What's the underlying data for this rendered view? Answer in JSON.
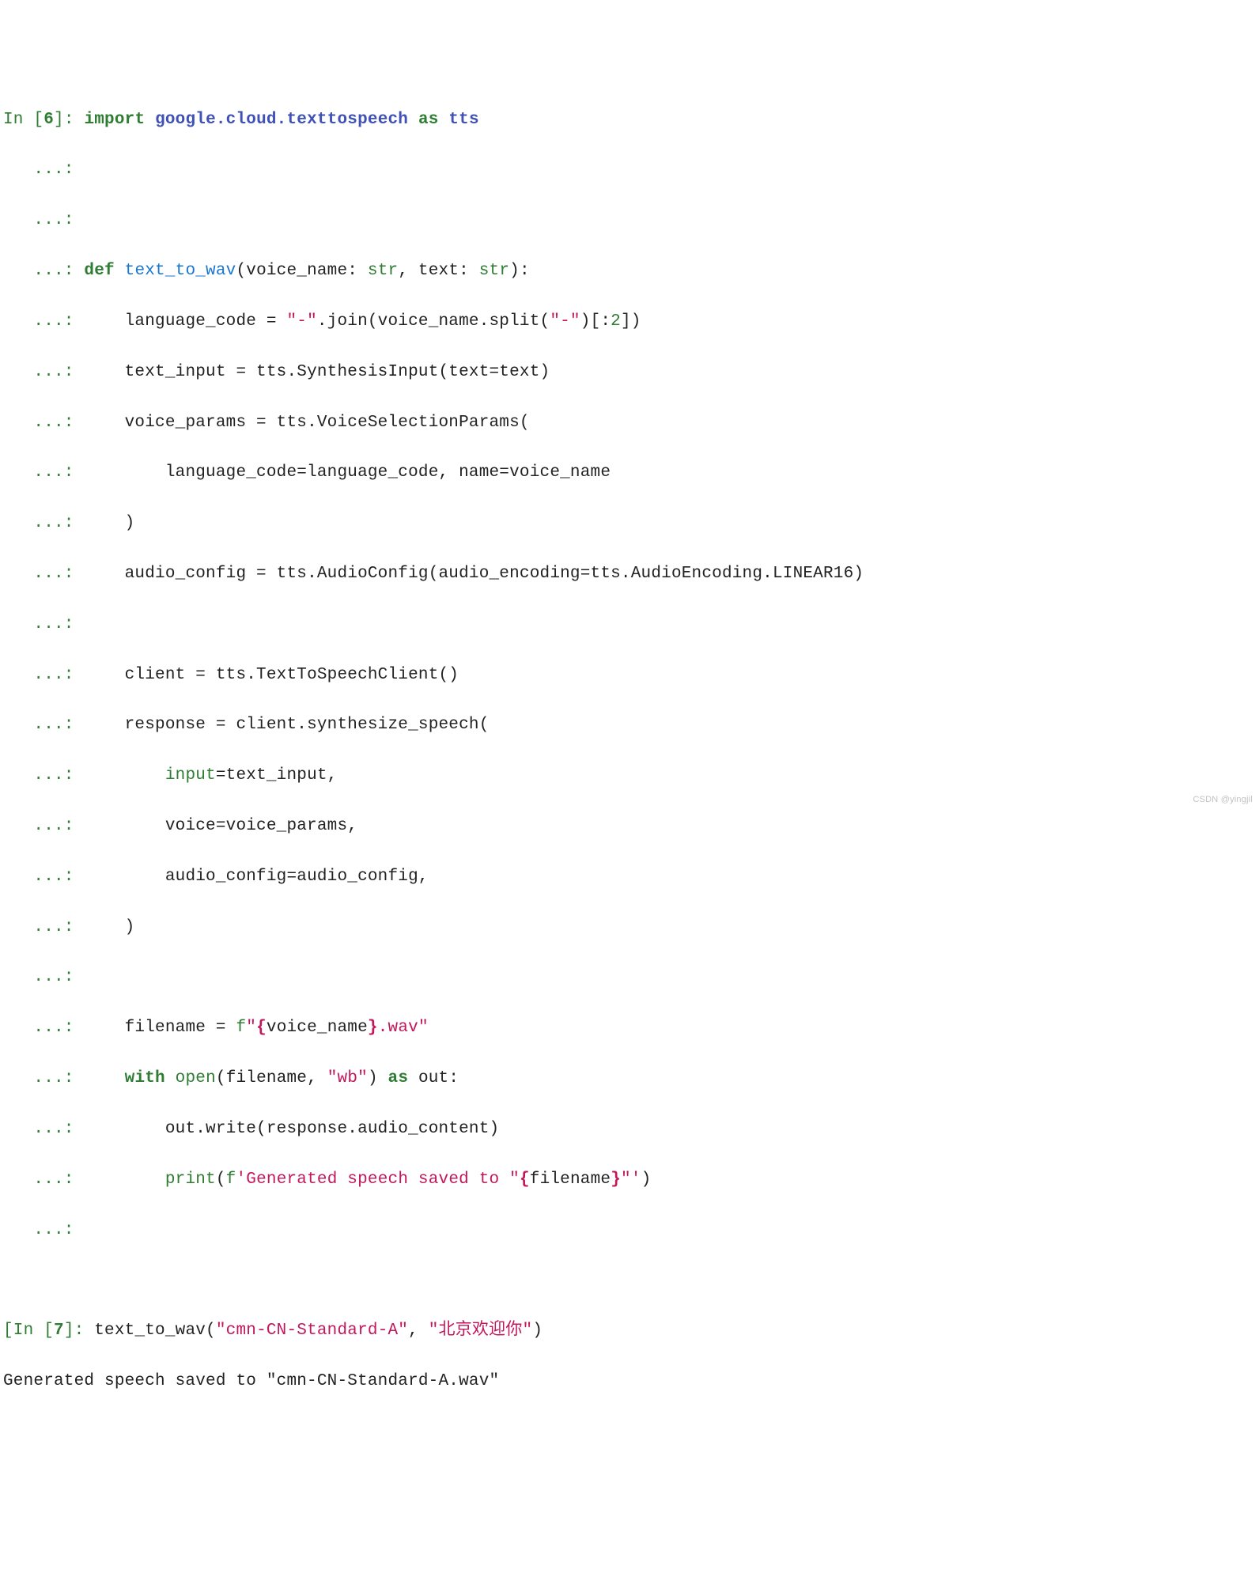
{
  "cells": {
    "cell6": {
      "prompt_in": "In [",
      "prompt_num": "6",
      "prompt_close": "]: ",
      "cont": "   ...: ",
      "line1": {
        "import": "import",
        "module": "google.cloud.texttospeech",
        "as": "as",
        "alias": "tts"
      },
      "line4": {
        "def": "def",
        "fname": "text_to_wav",
        "sig_open": "(voice_name: ",
        "type1": "str",
        "sig_mid": ", text: ",
        "type2": "str",
        "sig_close": "):"
      },
      "line5": {
        "indent": "    language_code = ",
        "str1": "\"-\"",
        "mid": ".join(voice_name.split(",
        "str2": "\"-\"",
        "tail": ")[:",
        "num": "2",
        "close": "])"
      },
      "line6": "    text_input = tts.SynthesisInput(text=text)",
      "line7": "    voice_params = tts.VoiceSelectionParams(",
      "line8": "        language_code=language_code, name=voice_name",
      "line9": "    )",
      "line10": "    audio_config = tts.AudioConfig(audio_encoding=tts.AudioEncoding.LINEAR16)",
      "line12": "    client = tts.TextToSpeechClient()",
      "line13": "    response = client.synthesize_speech(",
      "line14_head": "        ",
      "line14_input": "input",
      "line14_tail": "=text_input,",
      "line15": "        voice=voice_params,",
      "line16": "        audio_config=audio_config,",
      "line17": "    )",
      "line19": {
        "head": "    filename = ",
        "fpre": "f",
        "str_open": "\"",
        "brace_open": "{",
        "var": "voice_name",
        "brace_close": "}",
        "str_tail": ".wav\""
      },
      "line20": {
        "indent": "    ",
        "with": "with",
        "sp": " ",
        "open": "open",
        "args_open": "(filename, ",
        "mode": "\"wb\"",
        "args_close": ") ",
        "as": "as",
        "tail": " out:"
      },
      "line21": "        out.write(response.audio_content)",
      "line22": {
        "indent": "        ",
        "print": "print",
        "popen": "(",
        "fpre": "f",
        "str1": "'Generated speech saved to \"",
        "brace_open": "{",
        "var": "filename",
        "brace_close": "}",
        "str2": "\"'",
        "pclose": ")"
      }
    },
    "cell7": {
      "prompt_in": "[In [",
      "prompt_num": "7",
      "prompt_close": "]: ",
      "call_head": "text_to_wav(",
      "arg1": "\"cmn-CN-Standard-A\"",
      "sep": ", ",
      "arg2": "\"北京欢迎你\"",
      "call_tail": ")",
      "output": "Generated speech saved to \"cmn-CN-Standard-A.wav\""
    }
  },
  "watermark": "CSDN @yingjil"
}
